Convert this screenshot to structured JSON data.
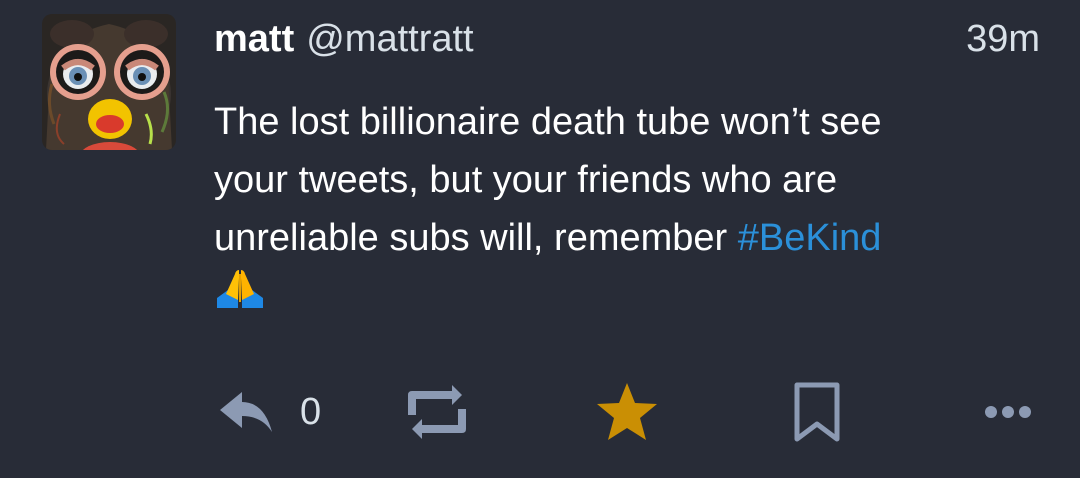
{
  "status": {
    "display_name": "matt",
    "acct": "@mattratt",
    "timestamp": "39m",
    "content": {
      "line1": "The lost billionaire death tube won’t see",
      "line2": "your tweets, but your friends who are",
      "line3_text": "unreliable subs will, remember ",
      "hashtag": "#BeKind",
      "emoji_icon": "folded-hands-emoji"
    },
    "avatar_icon": "furby-avatar"
  },
  "actions": {
    "reply": {
      "icon": "reply-icon",
      "count": "0"
    },
    "boost": {
      "icon": "boost-icon"
    },
    "favourite": {
      "icon": "star-icon",
      "color": "#ca8f04"
    },
    "bookmark": {
      "icon": "bookmark-icon"
    },
    "more": {
      "icon": "more-horizontal-icon"
    }
  },
  "colors": {
    "background": "#282c37",
    "text": "#ffffff",
    "secondary_text": "#d9e1e8",
    "link": "#2b90d9",
    "icon": "#8c9ab3",
    "favourite": "#ca8f04"
  }
}
